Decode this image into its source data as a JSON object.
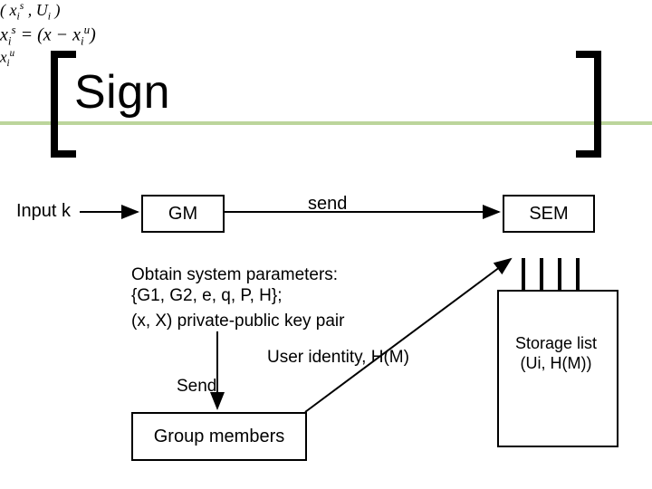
{
  "title": "Sign",
  "input_label": "Input k",
  "gm": "GM",
  "sem": "SEM",
  "send_label": "send",
  "send_math_html": "( x<span class='sub'>i</span><span class='sup'>s</span> , U<span class='sub'>i</span> )",
  "equation_html": "x<span class='sub'>i</span><span class='sup'>s</span> = (x − x<span class='sub'>i</span><span class='sup'>u</span>)",
  "obtain_line1": "Obtain system parameters:",
  "obtain_line2": "{G1, G2, e, q, P, H};",
  "keypair": "(x, X) private-public key pair",
  "user_identity": "User identity, H(M)",
  "send2_label": "Send",
  "send2_math_html": "x<span class='sub'>i</span><span class='sup'>u</span>",
  "group_members": "Group members",
  "storage_l1": "Storage list",
  "storage_l2": "(Ui, H(M))"
}
